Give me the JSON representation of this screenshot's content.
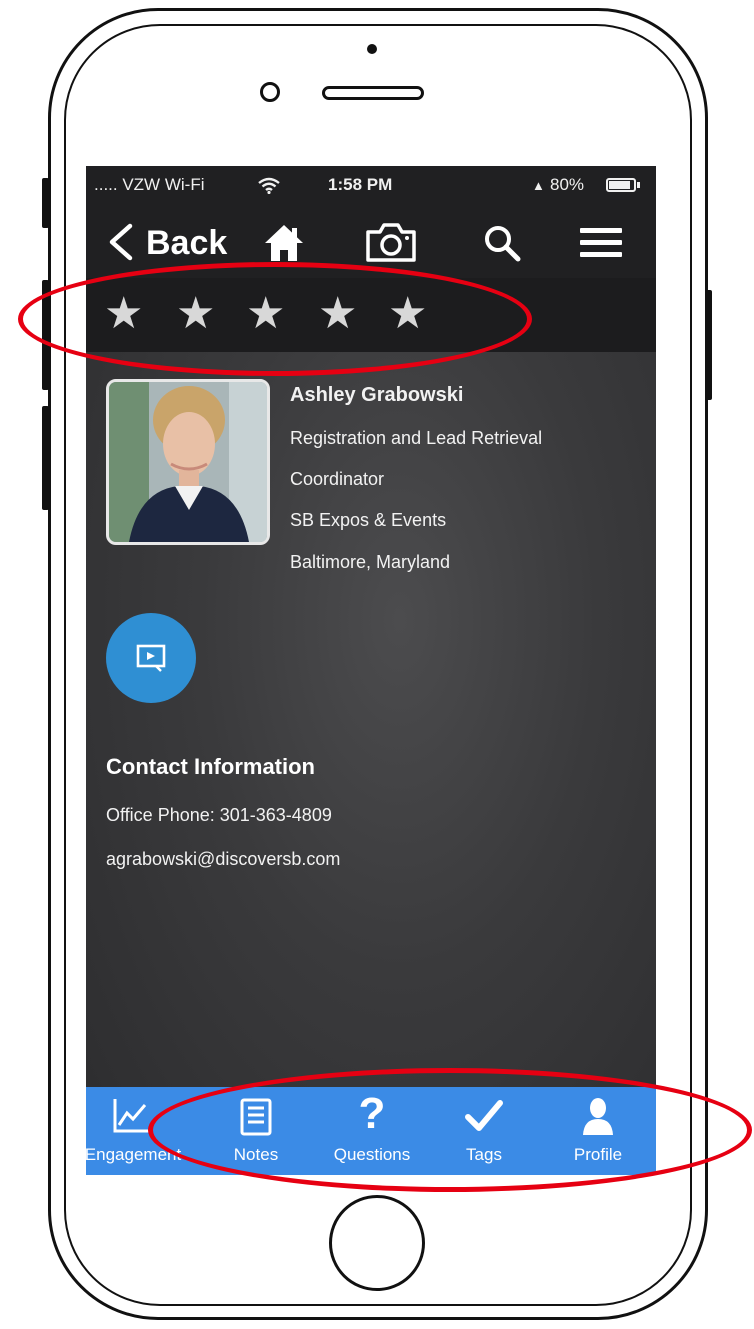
{
  "status_bar": {
    "carrier": "..... VZW Wi-Fi",
    "time": "1:58 PM",
    "battery": "80%"
  },
  "nav": {
    "back_label": "Back",
    "icons": [
      "chevron-left-icon",
      "home-icon",
      "camera-icon",
      "search-icon",
      "menu-icon"
    ]
  },
  "rating": {
    "stars": [
      "★",
      "★",
      "★",
      "★",
      "★"
    ]
  },
  "profile": {
    "name": "Ashley Grabowski",
    "title_line1": "Registration and Lead Retrieval",
    "title_line2": "Coordinator",
    "company": "SB Expos & Events",
    "location": "Baltimore, Maryland"
  },
  "contact": {
    "heading": "Contact Information",
    "phone": "Office Phone: 301-363-4809",
    "email": "agrabowski@discoversb.com"
  },
  "tabs": [
    {
      "label": "Engagement",
      "icon": "chart-icon"
    },
    {
      "label": "Notes",
      "icon": "notes-icon"
    },
    {
      "label": "Questions",
      "icon": "question-icon"
    },
    {
      "label": "Tags",
      "icon": "checkmark-icon"
    },
    {
      "label": "Profile",
      "icon": "person-icon"
    }
  ],
  "colors": {
    "accent": "#3b8be6",
    "annotation": "#e60012",
    "present_button": "#2f8fd3"
  }
}
